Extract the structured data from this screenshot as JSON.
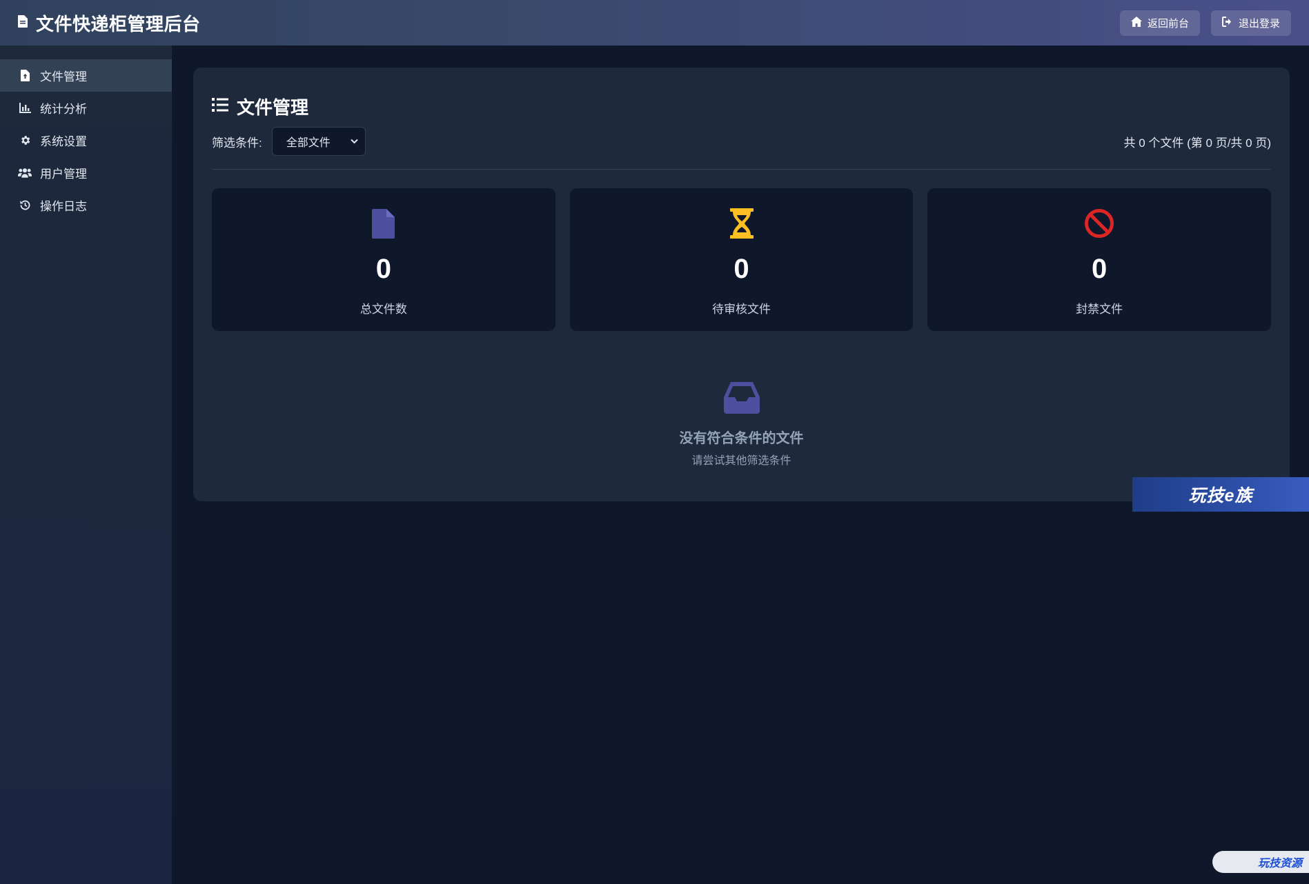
{
  "header": {
    "title": "文件快递柜管理后台",
    "title_icon": "file-icon",
    "buttons": [
      {
        "label": "返回前台",
        "icon": "home-icon"
      },
      {
        "label": "退出登录",
        "icon": "logout-icon"
      }
    ]
  },
  "sidebar": {
    "items": [
      {
        "label": "文件管理",
        "icon": "file-upload-icon",
        "active": true
      },
      {
        "label": "统计分析",
        "icon": "chart-icon",
        "active": false
      },
      {
        "label": "系统设置",
        "icon": "gear-icon",
        "active": false
      },
      {
        "label": "用户管理",
        "icon": "users-icon",
        "active": false
      },
      {
        "label": "操作日志",
        "icon": "history-icon",
        "active": false
      }
    ]
  },
  "main": {
    "title": "文件管理",
    "title_icon": "list-icon",
    "filter": {
      "label": "筛选条件:",
      "selected": "全部文件"
    },
    "file_count": "共 0 个文件 (第 0 页/共 0 页)",
    "stats": [
      {
        "value": "0",
        "label": "总文件数",
        "icon": "file-icon",
        "color": "#4f4fa0"
      },
      {
        "value": "0",
        "label": "待审核文件",
        "icon": "hourglass-icon",
        "color": "#fbbf24"
      },
      {
        "value": "0",
        "label": "封禁文件",
        "icon": "ban-icon",
        "color": "#dc2626"
      }
    ],
    "empty": {
      "icon": "inbox-icon",
      "title": "没有符合条件的文件",
      "subtitle": "请尝试其他筛选条件"
    }
  },
  "overlays": {
    "promo_text": "玩技e族",
    "watermark_text": "玩技资源"
  }
}
